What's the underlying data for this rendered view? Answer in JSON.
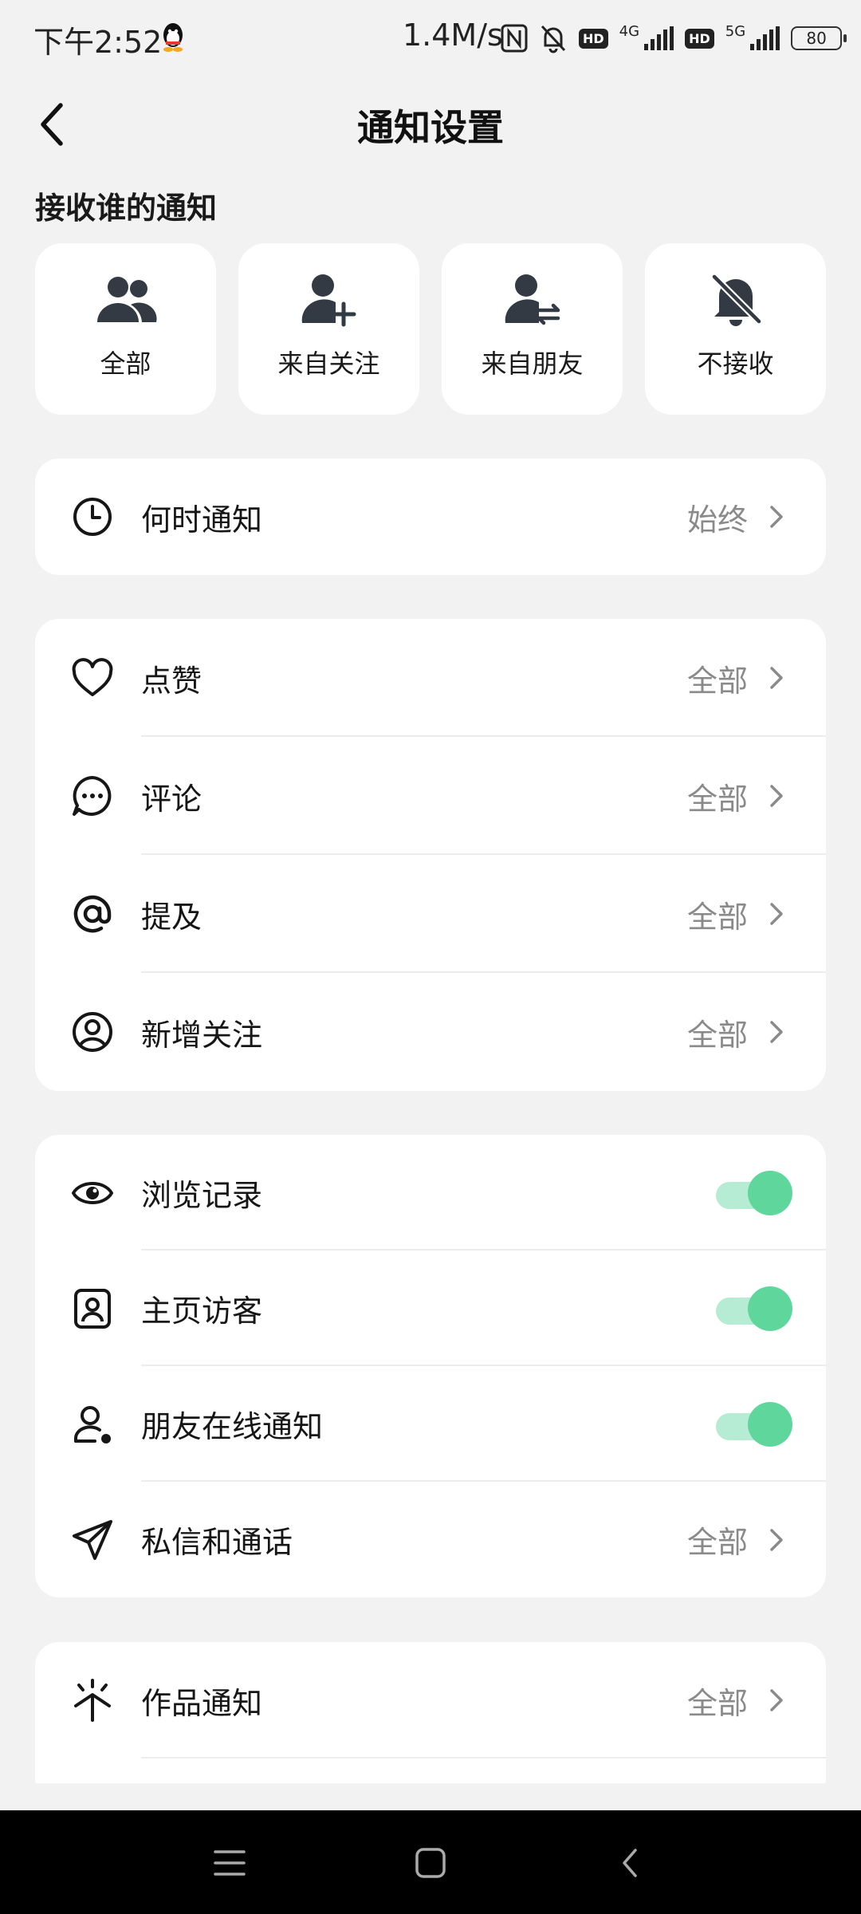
{
  "status_bar": {
    "time": "下午2:52",
    "speed": "1.4M/s",
    "hd1": "HD",
    "net1": "4G",
    "hd2": "HD",
    "net2": "5G",
    "battery": "80"
  },
  "header": {
    "title": "通知设置"
  },
  "receive_section": {
    "title": "接收谁的通知",
    "options": [
      {
        "label": "全部",
        "icon": "group-icon"
      },
      {
        "label": "来自关注",
        "icon": "user-add-icon"
      },
      {
        "label": "来自朋友",
        "icon": "user-exchange-icon"
      },
      {
        "label": "不接收",
        "icon": "bell-off-icon"
      }
    ]
  },
  "when": {
    "label": "何时通知",
    "value": "始终",
    "icon": "clock-icon"
  },
  "interactions": [
    {
      "label": "点赞",
      "value": "全部",
      "icon": "heart-icon"
    },
    {
      "label": "评论",
      "value": "全部",
      "icon": "comment-icon"
    },
    {
      "label": "提及",
      "value": "全部",
      "icon": "at-icon"
    },
    {
      "label": "新增关注",
      "value": "全部",
      "icon": "user-circle-icon"
    }
  ],
  "activity": [
    {
      "label": "浏览记录",
      "icon": "eye-icon",
      "toggle": true
    },
    {
      "label": "主页访客",
      "icon": "profile-card-icon",
      "toggle": true
    },
    {
      "label": "朋友在线通知",
      "icon": "user-online-icon",
      "toggle": true
    },
    {
      "label": "私信和通话",
      "value": "全部",
      "icon": "send-icon"
    }
  ],
  "works": {
    "label": "作品通知",
    "value": "全部",
    "icon": "sparkle-icon"
  },
  "colors": {
    "accent": "#5fd79c",
    "accent_track": "#b6ecd3",
    "background": "#f2f2f2"
  },
  "nav": [
    "menu-icon",
    "home-square-icon",
    "back-triangle-icon"
  ]
}
